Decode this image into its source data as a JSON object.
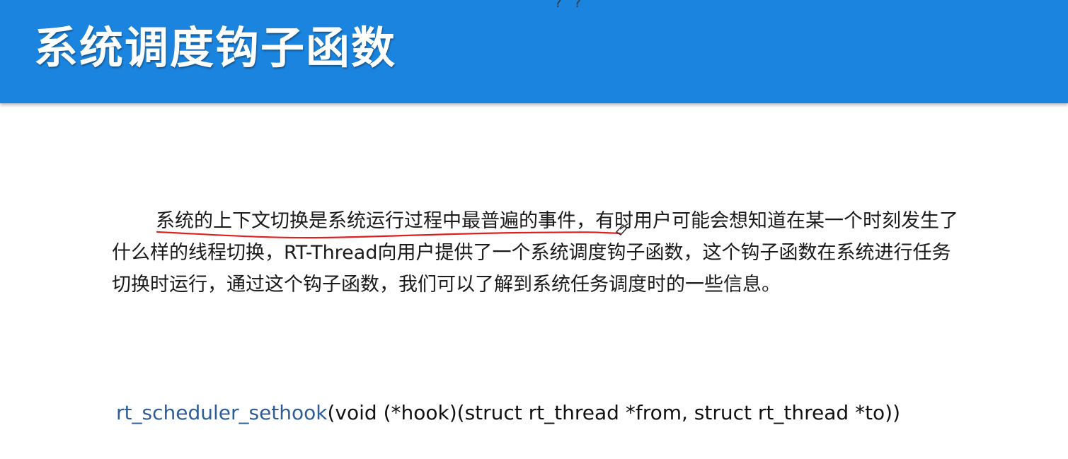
{
  "top_marks": "? ?",
  "slide": {
    "title": "系统调度钩子函数"
  },
  "content": {
    "highlighted_sentence": "系统的上下文切换是系统运行过程中最普遍的事件，",
    "rest_text": "有时用户可能会想知道在某一个时刻发生了什么样的线程切换，RT-Thread向用户提供了一个系统调度钩子函数，这个钩子函数在系统进行任务切换时运行，通过这个钩子函数，我们可以了解到系统任务调度时的一些信息。"
  },
  "code": {
    "function_name": "rt_scheduler_sethook",
    "signature": "(void (*hook)(struct rt_thread *from, struct rt_thread *to))"
  },
  "colors": {
    "header": "#1b84de",
    "function_name": "#2e5d96",
    "annotation_underline": "#e02020"
  }
}
